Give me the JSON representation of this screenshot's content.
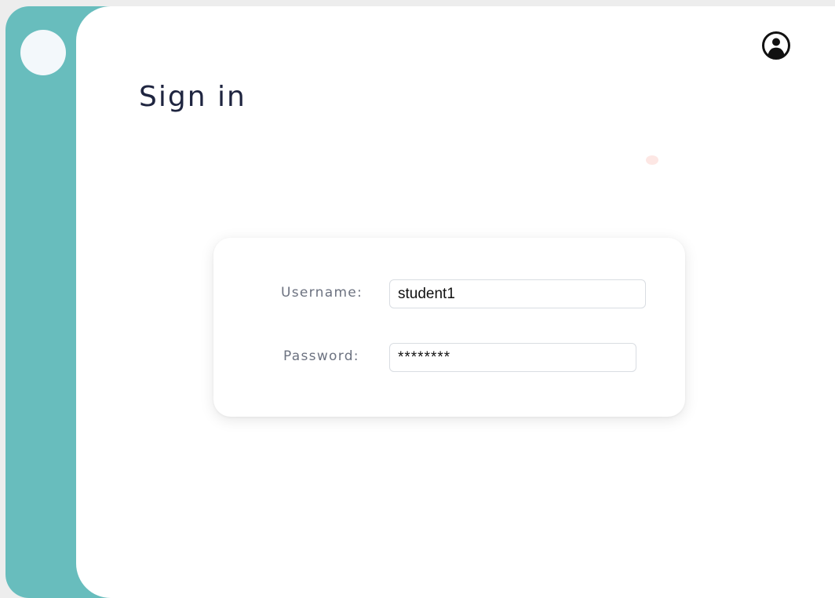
{
  "page": {
    "title": "Sign in"
  },
  "header": {
    "account_icon": "user-circle-icon"
  },
  "login_form": {
    "username_label": "Username:",
    "username_value": "student1",
    "password_label": "Password:",
    "password_value": "********"
  },
  "colors": {
    "sidebar": "#68bdbd",
    "sidebar_dot": "#f3f8fb",
    "title_text": "#1f2540",
    "label_text": "#6c7280",
    "accent_dot": "#fde7e4"
  }
}
